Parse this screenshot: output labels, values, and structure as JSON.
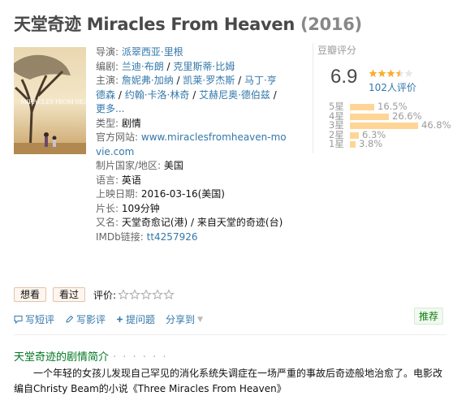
{
  "title": {
    "name": "天堂奇迹 Miracles From Heaven",
    "year": "(2016)"
  },
  "poster": {
    "overlay_text": "MIRACLES FROM HEAVEN"
  },
  "info": {
    "director_label": "导演:",
    "director": "派翠西亚·里根",
    "writer_label": "编剧:",
    "writer1": "兰迪·布朗",
    "writer2": "克里斯蒂·比姆",
    "cast_label": "主演:",
    "cast1": "詹妮弗·加纳",
    "cast2": "凯莱·罗杰斯",
    "cast3": "马丁·亨",
    "cast3b": "德森",
    "cast4": "约翰·卡洛·林奇",
    "cast5": "艾赫尼奥·德伯兹",
    "more": "更多...",
    "separator": "/",
    "genre_label": "类型:",
    "genre": "剧情",
    "website_label": "官方网站:",
    "website_line1": "www.miraclesfromheaven-mo",
    "website_line2": "vie.com",
    "country_label": "制片国家/地区:",
    "country": "美国",
    "language_label": "语言:",
    "language": "英语",
    "release_label": "上映日期:",
    "release": "2016-03-16(美国)",
    "runtime_label": "片长:",
    "runtime": "109分钟",
    "aka_label": "又名:",
    "aka": "天堂奇愈记(港) / 来自天堂的奇迹(台)",
    "imdb_label": "IMDb链接:",
    "imdb": "tt4257926"
  },
  "rating": {
    "header": "豆瓣评分",
    "score": "6.9",
    "stars": 3.5,
    "votes": "102人评价",
    "distribution": [
      {
        "label": "5星",
        "percent": 16.5,
        "text": "16.5%"
      },
      {
        "label": "4星",
        "percent": 26.6,
        "text": "26.6%"
      },
      {
        "label": "3星",
        "percent": 46.8,
        "text": "46.8%"
      },
      {
        "label": "2星",
        "percent": 6.3,
        "text": "6.3%"
      },
      {
        "label": "1星",
        "percent": 3.8,
        "text": "3.8%"
      }
    ]
  },
  "actions": {
    "want": "想看",
    "seen": "看过",
    "rate_label": "评价:"
  },
  "links": {
    "short_review": "写短评",
    "review": "写影评",
    "question": "提问题",
    "share": "分享到"
  },
  "recommend": "推荐",
  "summary": {
    "title": "天堂奇迹的剧情简介",
    "dots": "· · · · · ·",
    "text": "一个年轻的女孩儿发现自己罕见的消化系统失调症在一场严重的事故后奇迹般地治愈了。电影改编自Christy Beam的小说《Three Miracles From Heaven》"
  },
  "colors": {
    "link": "#3377aa",
    "star": "#ffac2d",
    "bar": "#ffd596",
    "section": "#007722"
  }
}
